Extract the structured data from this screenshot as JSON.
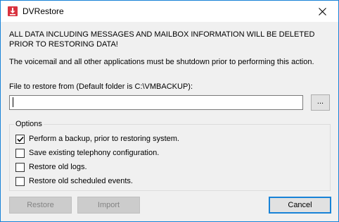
{
  "window": {
    "title": "DVRestore",
    "app_icon": "download-arrow-icon",
    "close_icon": "close-icon"
  },
  "messages": {
    "warning": "ALL DATA INCLUDING MESSAGES AND MAILBOX INFORMATION WILL BE DELETED PRIOR TO RESTORING DATA!",
    "info": "The voicemail and all other applications must be shutdown prior to performing this action."
  },
  "file": {
    "label": "File to restore from (Default folder is C:\\VMBACKUP):",
    "value": "",
    "browse_label": "..."
  },
  "options": {
    "legend": "Options",
    "items": [
      {
        "label": "Perform a backup, prior to restoring system.",
        "checked": true
      },
      {
        "label": "Save existing telephony configuration.",
        "checked": false
      },
      {
        "label": "Restore old logs.",
        "checked": false
      },
      {
        "label": "Restore old scheduled events.",
        "checked": false
      }
    ]
  },
  "buttons": {
    "restore": "Restore",
    "import": "Import",
    "cancel": "Cancel"
  },
  "colors": {
    "accent": "#1883d7",
    "icon_red": "#d9333f",
    "disabled_text": "#838383"
  }
}
